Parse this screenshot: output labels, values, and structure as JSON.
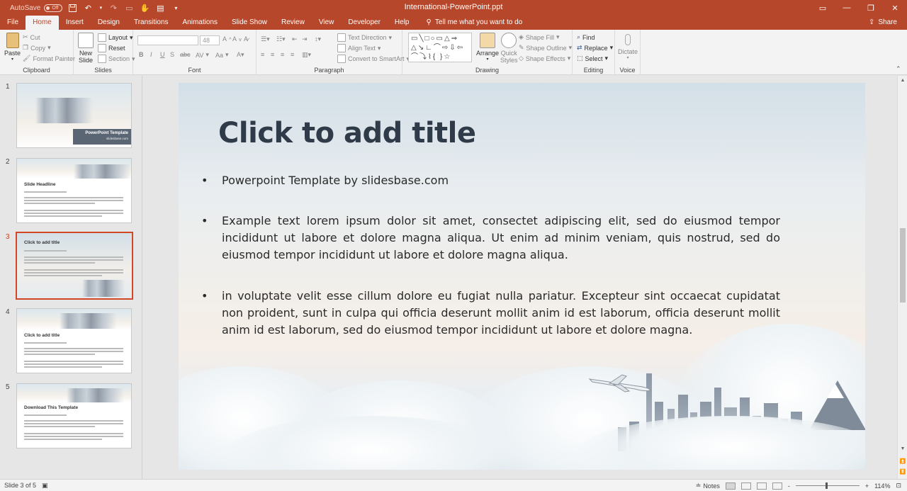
{
  "titlebar": {
    "autosave_label": "AutoSave",
    "autosave_state": "Off",
    "document_title": "International-PowerPoint.ppt"
  },
  "tabs": [
    "File",
    "Home",
    "Insert",
    "Design",
    "Transitions",
    "Animations",
    "Slide Show",
    "Review",
    "View",
    "Developer",
    "Help"
  ],
  "active_tab": "Home",
  "tell_me": "Tell me what you want to do",
  "share_label": "Share",
  "ribbon": {
    "clipboard": {
      "label": "Clipboard",
      "paste": "Paste",
      "cut": "Cut",
      "copy": "Copy",
      "format_painter": "Format Painter"
    },
    "slides": {
      "label": "Slides",
      "new_slide": "New",
      "new_slide2": "Slide",
      "layout": "Layout",
      "reset": "Reset",
      "section": "Section"
    },
    "font": {
      "label": "Font",
      "size": "48",
      "bold": "B",
      "italic": "I",
      "underline": "U",
      "strike": "S",
      "abc": "abc",
      "av": "AV",
      "aa": "Aa"
    },
    "paragraph": {
      "label": "Paragraph",
      "text_direction": "Text Direction",
      "align_text": "Align Text",
      "convert_smartart": "Convert to SmartArt"
    },
    "drawing": {
      "label": "Drawing",
      "arrange": "Arrange",
      "quick": "Quick",
      "styles": "Styles",
      "shape_fill": "Shape Fill",
      "shape_outline": "Shape Outline",
      "shape_effects": "Shape Effects"
    },
    "editing": {
      "label": "Editing",
      "find": "Find",
      "replace": "Replace",
      "select": "Select"
    },
    "voice": {
      "label": "Voice",
      "dictate": "Dictate"
    }
  },
  "thumbnails": [
    {
      "num": "1",
      "title": "PowerPoint Template",
      "sub": "slidesbase.com"
    },
    {
      "num": "2",
      "title": "Slide Headline"
    },
    {
      "num": "3",
      "title": "Click to add title"
    },
    {
      "num": "4",
      "title": "Click to add title"
    },
    {
      "num": "5",
      "title": "Download This Template"
    }
  ],
  "slide": {
    "title": "Click to add title",
    "bullets": [
      "Powerpoint Template by slidesbase.com",
      "Example text lorem ipsum dolor sit amet, consectet adipiscing elit, sed do eiusmod tempor incididunt ut labore et dolore magna aliqua. Ut enim ad minim veniam, quis nostrud, sed do eiusmod tempor incididunt ut labore et dolore magna aliqua.",
      "in voluptate velit esse cillum dolore eu fugiat nulla pariatur. Excepteur sint occaecat cupidatat non proident, sunt in culpa qui officia deserunt mollit anim id est laborum, officia deserunt mollit anim id est laborum, sed do eiusmod tempor incididunt ut labore et dolore magna."
    ]
  },
  "status": {
    "slide_indicator": "Slide 3 of 5",
    "notes": "Notes",
    "zoom": "114%",
    "zoom_minus": "-",
    "zoom_plus": "+"
  },
  "colors": {
    "brand": "#b7472a",
    "selection": "#d24726"
  }
}
